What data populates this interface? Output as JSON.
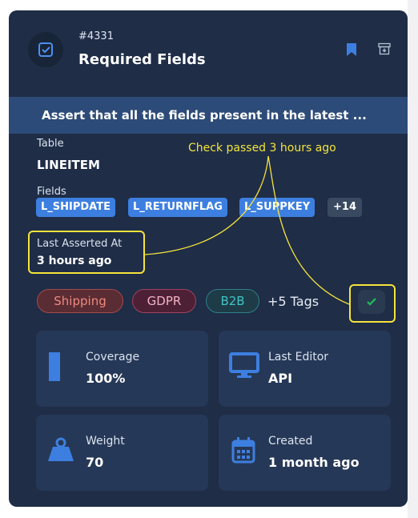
{
  "header": {
    "id": "#4331",
    "title": "Required Fields"
  },
  "description": "Assert that all the fields present in the latest ...",
  "table": {
    "label": "Table",
    "value": "LINEITEM"
  },
  "fields": {
    "label": "Fields",
    "items": [
      "L_SHIPDATE",
      "L_RETURNFLAG",
      "L_SUPPKEY"
    ],
    "more": "+14"
  },
  "last_asserted": {
    "label": "Last Asserted At",
    "value": "3 hours ago"
  },
  "tags": {
    "items": [
      "Shipping",
      "GDPR",
      "B2B"
    ],
    "more": "+5 Tags"
  },
  "annotation": "Check passed 3 hours ago",
  "tiles": {
    "coverage": {
      "label": "Coverage",
      "value": "100%"
    },
    "last_editor": {
      "label": "Last Editor",
      "value": "API"
    },
    "weight": {
      "label": "Weight",
      "value": "70"
    },
    "created": {
      "label": "Created",
      "value": "1 month ago"
    }
  },
  "colors": {
    "card_bg": "#1f2d47",
    "accent_blue": "#3d7fe0",
    "highlight_yellow": "#f5e43a",
    "check_green": "#22b35a"
  },
  "icons": {
    "header": "checkbox-icon",
    "bookmark": "bookmark-icon",
    "archive": "archive-icon",
    "status": "check-icon",
    "coverage": "bar-icon",
    "editor": "monitor-icon",
    "weight": "weight-icon",
    "created": "calendar-icon"
  }
}
